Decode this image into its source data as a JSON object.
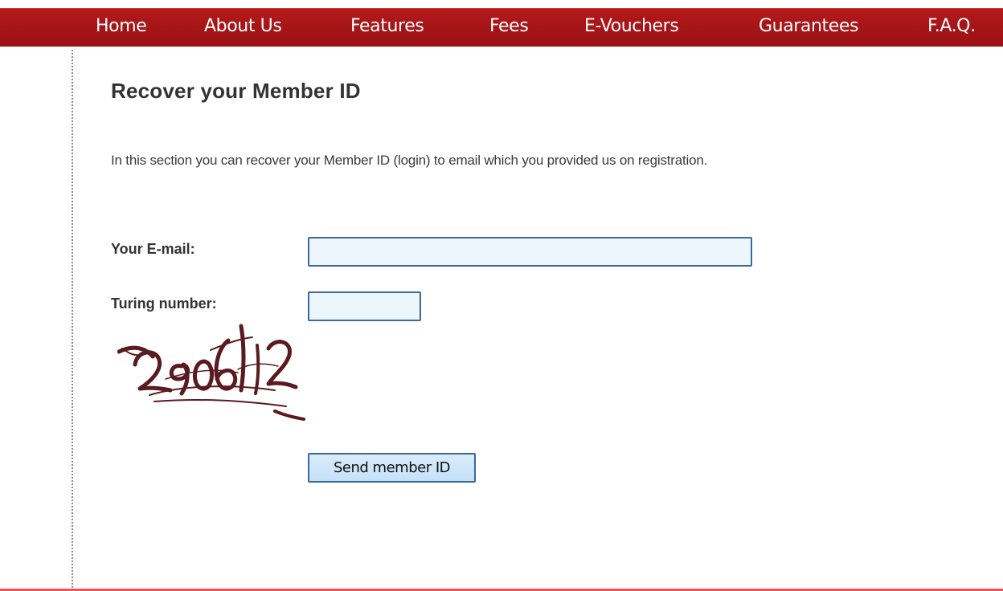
{
  "nav": {
    "items": [
      {
        "label": "Home"
      },
      {
        "label": "About Us"
      },
      {
        "label": "Features"
      },
      {
        "label": "Fees"
      },
      {
        "label": "E-Vouchers"
      },
      {
        "label": "Guarantees"
      },
      {
        "label": "F.A.Q."
      }
    ]
  },
  "main": {
    "title": "Recover your Member ID",
    "intro": "In this section you can recover your Member ID (login) to email which you provided us on registration."
  },
  "form": {
    "email_label": "Your E-mail:",
    "email_value": "",
    "turing_label": "Turing number:",
    "turing_value": "",
    "captcha_text": "2906112",
    "submit_label": "Send member ID"
  },
  "colors": {
    "nav_background": "#a51416",
    "input_background": "#eef6fd",
    "input_border": "#3a6a9c",
    "captcha_ink": "#5a1a1f"
  }
}
